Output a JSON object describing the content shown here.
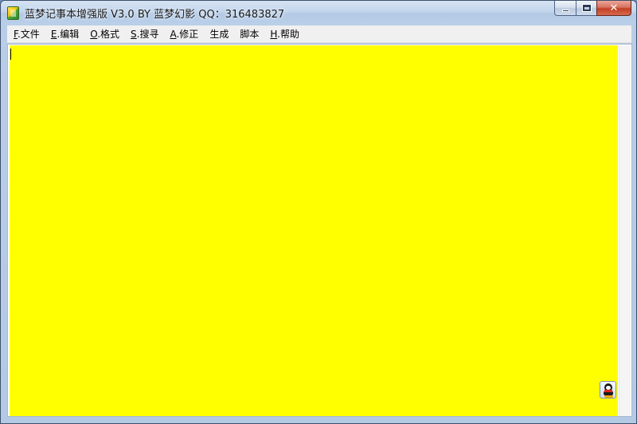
{
  "window": {
    "title": "蓝梦记事本增强版 V3.0 BY 蓝梦幻影 QQ：316483827",
    "controls": {
      "minimize": "minimize",
      "maximize": "maximize",
      "close": "✕"
    }
  },
  "menu": [
    {
      "key": "F",
      "label": ".文件"
    },
    {
      "key": "E",
      "label": ".编辑"
    },
    {
      "key": "O",
      "label": ".格式"
    },
    {
      "key": "S",
      "label": ".搜寻"
    },
    {
      "key": "A",
      "label": ".修正"
    },
    {
      "key": "",
      "label": "生成"
    },
    {
      "key": "",
      "label": "脚本"
    },
    {
      "key": "H",
      "label": ".帮助"
    }
  ],
  "editor": {
    "content": "",
    "background": "#ffff00"
  },
  "icons": {
    "app": "notepad-app-icon",
    "tray": "qq-penguin-icon"
  }
}
